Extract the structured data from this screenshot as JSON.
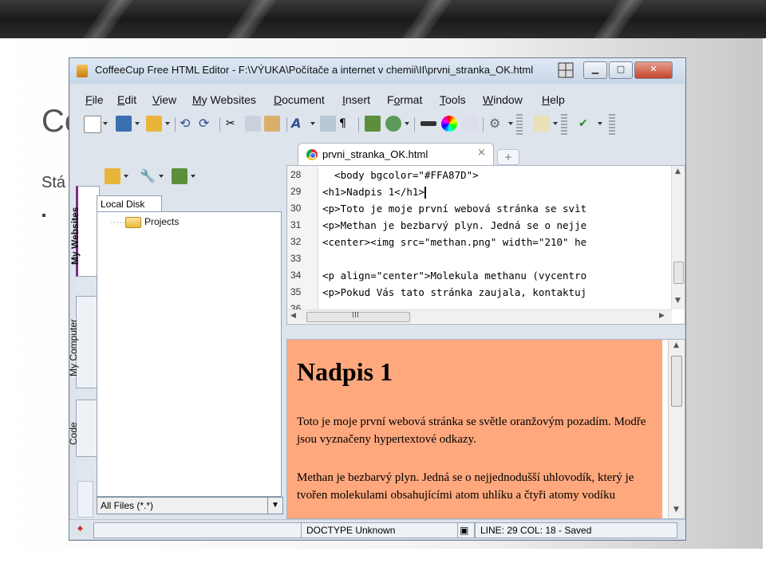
{
  "background": {
    "title_partial": "Co",
    "subtitle_partial": "Stá",
    "bullet": "▪"
  },
  "window": {
    "title": "CoffeeCup Free HTML Editor - F:\\VÝUKA\\Počítače a internet v chemii\\II\\prvni_stranka_OK.html",
    "minimize": "▁",
    "maximize": "□",
    "close": "✕"
  },
  "menu": [
    {
      "label": "File",
      "key": "F"
    },
    {
      "label": "Edit",
      "key": "E"
    },
    {
      "label": "View",
      "key": "V"
    },
    {
      "label": "My Websites",
      "key": "M"
    },
    {
      "label": "Document",
      "key": "D"
    },
    {
      "label": "Insert",
      "key": "I"
    },
    {
      "label": "Format",
      "key": "o"
    },
    {
      "label": "Tools",
      "key": "T"
    },
    {
      "label": "Window",
      "key": "W"
    },
    {
      "label": "Help",
      "key": "H"
    }
  ],
  "side_tabs": {
    "my_websites": "My Websites",
    "my_computer": "My Computer",
    "code": "Code"
  },
  "left_pane": {
    "tab": "Local Disk",
    "tree": [
      "Projects"
    ],
    "filter": "All Files (*.*)"
  },
  "editor": {
    "tab_name": "prvni_stranka_OK.html",
    "tab_close": "×",
    "lines": [
      {
        "n": "28",
        "text": "  <body bgcolor=\"#FFA87D\">"
      },
      {
        "n": "29",
        "text": "<h1>Nadpis 1</h1>"
      },
      {
        "n": "30",
        "text": "<p>Toto je moje první webová stránka se svìt"
      },
      {
        "n": "31",
        "text": "<p>Methan je bezbarvý plyn. Jedná se o nejje"
      },
      {
        "n": "32",
        "text": "<center><img src=\"methan.png\" width=\"210\" he"
      },
      {
        "n": "33",
        "text": ""
      },
      {
        "n": "34",
        "text": "<p align=\"center\">Molekula methanu (vycentro"
      },
      {
        "n": "35",
        "text": "<p>Pokud Vás tato stránka zaujala, kontaktuj"
      },
      {
        "n": "36",
        "text": ""
      }
    ],
    "hscroll_thumb": "III"
  },
  "preview": {
    "bgcolor": "#FFA87D",
    "heading": "Nadpis 1",
    "paragraph1": "Toto je moje první webová stránka se světle oranžovým pozadím. Modře jsou vyznačeny hypertextové odkazy.",
    "paragraph2": "Methan je bezbarvý plyn. Jedná se o nejjednodušší uhlovodík, který je tvořen molekulami obsahujícími atom uhlíku a čtyři atomy vodíku"
  },
  "status": {
    "doctype": "DOCTYPE Unknown",
    "position": "LINE: 29  COL: 18 - Saved"
  }
}
